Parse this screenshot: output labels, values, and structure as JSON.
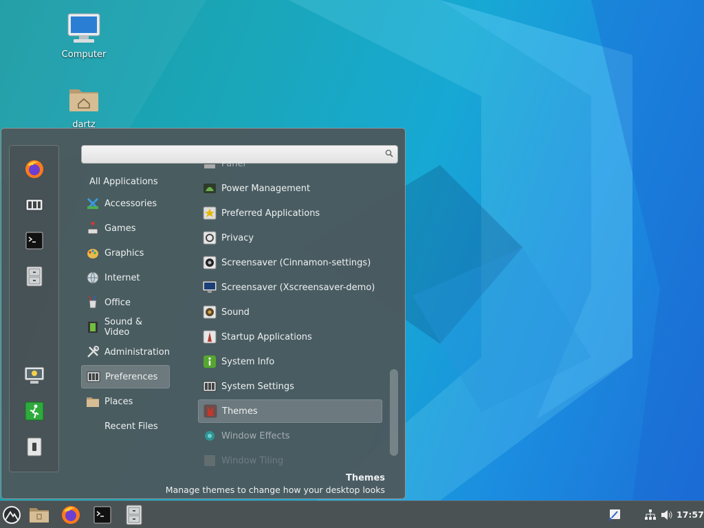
{
  "desktop": {
    "icons": [
      {
        "label": "Computer",
        "icon": "computer-icon"
      },
      {
        "label": "dartz",
        "icon": "home-folder-icon"
      }
    ]
  },
  "menu": {
    "search": {
      "value": "",
      "placeholder": ""
    },
    "favorites": [
      "firefox-icon",
      "system-settings-icon",
      "terminal-icon",
      "file-cabinet-icon"
    ],
    "session": [
      "lock-screen-icon",
      "logout-icon",
      "shutdown-icon"
    ],
    "categories": [
      {
        "label": "All Applications",
        "icon": ""
      },
      {
        "label": "Accessories",
        "icon": "accessories-icon"
      },
      {
        "label": "Games",
        "icon": "games-icon"
      },
      {
        "label": "Graphics",
        "icon": "graphics-icon"
      },
      {
        "label": "Internet",
        "icon": "internet-icon"
      },
      {
        "label": "Office",
        "icon": "office-icon"
      },
      {
        "label": "Sound & Video",
        "icon": "sound-video-icon"
      },
      {
        "label": "Administration",
        "icon": "administration-icon"
      },
      {
        "label": "Preferences",
        "icon": "preferences-icon",
        "selected": true
      },
      {
        "label": "Places",
        "icon": "folder-icon"
      },
      {
        "label": "Recent Files",
        "icon": ""
      }
    ],
    "apps": [
      {
        "label": "Panel",
        "icon": "panel-icon"
      },
      {
        "label": "Power Management",
        "icon": "power-management-icon"
      },
      {
        "label": "Preferred Applications",
        "icon": "preferred-apps-icon"
      },
      {
        "label": "Privacy",
        "icon": "privacy-icon"
      },
      {
        "label": "Screensaver (Cinnamon-settings)",
        "icon": "screensaver-icon"
      },
      {
        "label": "Screensaver (Xscreensaver-demo)",
        "icon": "xscreensaver-icon"
      },
      {
        "label": "Sound",
        "icon": "sound-icon"
      },
      {
        "label": "Startup Applications",
        "icon": "startup-apps-icon"
      },
      {
        "label": "System Info",
        "icon": "system-info-icon"
      },
      {
        "label": "System Settings",
        "icon": "system-settings-icon"
      },
      {
        "label": "Themes",
        "icon": "themes-icon",
        "selected": true
      },
      {
        "label": "Window Effects",
        "icon": "window-effects-icon"
      },
      {
        "label": "Window Tiling",
        "icon": "window-tiling-icon"
      }
    ],
    "description": {
      "title": "Themes",
      "text": "Manage themes to change how your desktop looks"
    }
  },
  "panel": {
    "launchers": [
      "menu-icon",
      "file-manager-icon",
      "firefox-icon",
      "terminal-icon",
      "file-cabinet-icon"
    ],
    "tray": [
      "accessibility-icon",
      "network-icon",
      "volume-icon"
    ],
    "clock": "17:57"
  }
}
